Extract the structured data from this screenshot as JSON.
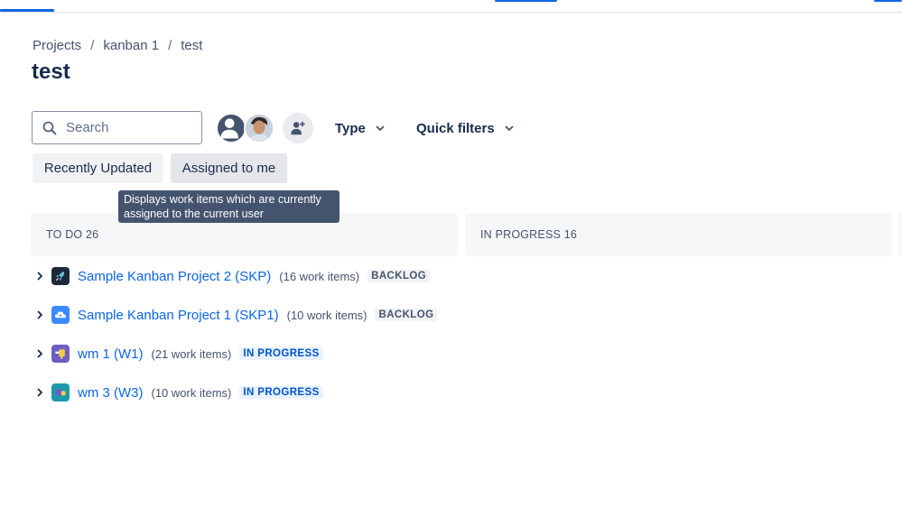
{
  "breadcrumb": {
    "items": [
      "Projects",
      "kanban 1",
      "test"
    ],
    "separator": "/"
  },
  "page": {
    "title": "test"
  },
  "search": {
    "placeholder": "Search"
  },
  "filters": {
    "type_label": "Type",
    "quick_filters_label": "Quick filters"
  },
  "chips": {
    "recently_updated": "Recently Updated",
    "assigned_to_me": "Assigned to me"
  },
  "tooltip": {
    "line1": "Displays work items which are currently",
    "line2": "assigned to the current user"
  },
  "columns": [
    {
      "header": "TO DO 26"
    },
    {
      "header": "IN PROGRESS 16"
    }
  ],
  "rows": [
    {
      "name": "Sample Kanban Project 2 (SKP)",
      "count": "(16 work items)",
      "status": "BACKLOG",
      "icon": "rocket-icon",
      "icon_color": "#1d2939"
    },
    {
      "name": "Sample Kanban Project 1 (SKP1)",
      "count": "(10 work items)",
      "status": "BACKLOG",
      "icon": "cloud-icon",
      "icon_color": "#388bff"
    },
    {
      "name": "wm 1 (W1)",
      "count": "(21 work items)",
      "status": "IN PROGRESS",
      "icon": "board-icon",
      "icon_color": "#6e5dc6"
    },
    {
      "name": "wm 3 (W3)",
      "count": "(10 work items)",
      "status": "IN PROGRESS",
      "icon": "box-icon",
      "icon_color": "#1d9aaa"
    }
  ],
  "colors": {
    "link": "#0c66e4",
    "text": "#172b4d",
    "subtle": "#44546f",
    "tooltip_bg": "#44546f"
  }
}
